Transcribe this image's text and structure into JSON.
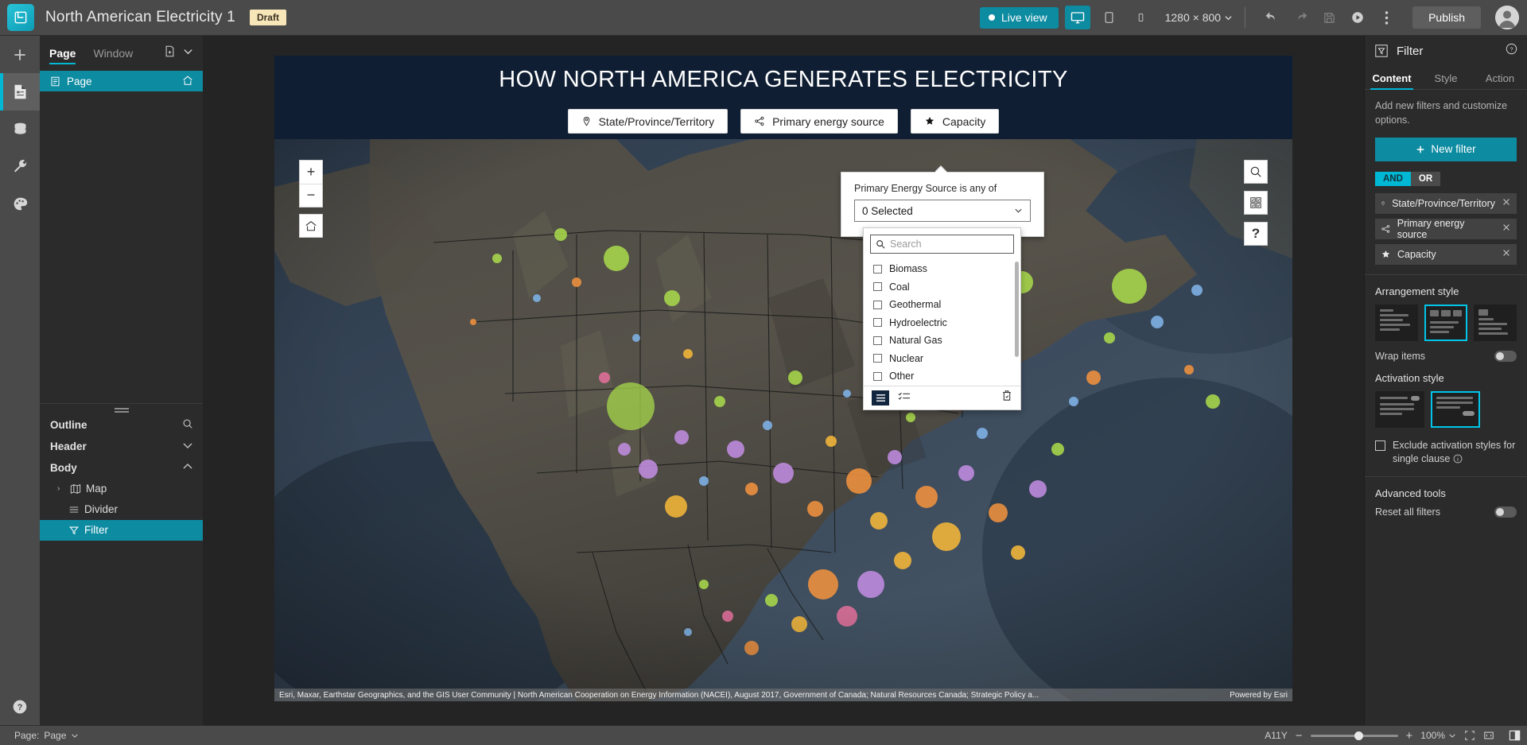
{
  "topbar": {
    "app_title": "North American Electricity 1",
    "draft_badge": "Draft",
    "live_view": "Live view",
    "device_size": "1280 × 800",
    "publish": "Publish",
    "icons": {
      "desktop": "desktop-icon",
      "tablet": "tablet-icon",
      "phone": "phone-icon",
      "undo": "undo-icon",
      "redo": "redo-icon",
      "save": "save-icon",
      "preview": "preview-icon",
      "more": "more-options-icon",
      "avatar": "user-avatar-icon"
    }
  },
  "rail": {
    "items": [
      {
        "name": "add-widget",
        "icon": "plus-icon"
      },
      {
        "name": "page-content",
        "icon": "page-document-icon",
        "active": true
      },
      {
        "name": "data",
        "icon": "database-icon"
      },
      {
        "name": "tools",
        "icon": "wrench-icon"
      },
      {
        "name": "theme",
        "icon": "palette-icon"
      }
    ],
    "help": "help-circle-icon"
  },
  "left_panel": {
    "tabs": [
      {
        "label": "Page",
        "selected": true
      },
      {
        "label": "Window",
        "selected": false
      }
    ],
    "add_page_icon": "add-page-icon",
    "chevron_icon": "chevron-down-icon",
    "pages": [
      {
        "label": "Page",
        "selected": true,
        "home": true
      }
    ],
    "outline": {
      "title": "Outline",
      "search_icon": "search-icon",
      "groups": [
        {
          "label": "Header",
          "expanded": false,
          "chevron": "chevron-down-icon"
        },
        {
          "label": "Body",
          "expanded": true,
          "chevron": "chevron-up-icon"
        }
      ],
      "items": [
        {
          "label": "Map",
          "icon": "map-icon",
          "arrow": "›",
          "selected": false
        },
        {
          "label": "Divider",
          "icon": "divider-icon",
          "arrow": "",
          "selected": false
        },
        {
          "label": "Filter",
          "icon": "filter-icon",
          "arrow": "",
          "selected": true
        }
      ]
    }
  },
  "artboard": {
    "title": "HOW NORTH AMERICA GENERATES ELECTRICITY",
    "filter_buttons": [
      {
        "label": "State/Province/Territory",
        "icon": "location-pin-icon"
      },
      {
        "label": "Primary energy source",
        "icon": "share-nodes-icon",
        "active": true
      },
      {
        "label": "Capacity",
        "icon": "star-icon"
      }
    ],
    "map_controls": {
      "zoom_in": "+",
      "zoom_out": "−",
      "home": "home-icon",
      "search": "search-icon",
      "legend": "legend-grid-icon",
      "help": "?"
    },
    "attribution": "Esri, Maxar, Earthstar Geographics, and the GIS User Community | North American Cooperation on Energy Information (NACEI), August 2017, Government of Canada; Natural Resources Canada; Strategic Policy a...",
    "powered_by": "Powered by Esri"
  },
  "popup": {
    "label": "Primary Energy Source is any of",
    "selected_text": "0 Selected",
    "chevron_icon": "chevron-down-icon",
    "search_placeholder": "Search",
    "search_icon": "search-icon",
    "options": [
      {
        "label": "Biomass",
        "checked": false
      },
      {
        "label": "Coal",
        "checked": false
      },
      {
        "label": "Geothermal",
        "checked": false
      },
      {
        "label": "Hydroelectric",
        "checked": false
      },
      {
        "label": "Natural Gas",
        "checked": false
      },
      {
        "label": "Nuclear",
        "checked": false
      },
      {
        "label": "Other",
        "checked": false
      }
    ],
    "footer_icons": {
      "list_view": "list-view-icon",
      "select_view": "checklist-icon",
      "delete": "trash-icon"
    }
  },
  "right_panel": {
    "header_title": "Filter",
    "header_icon": "filter-icon",
    "help_icon": "help-circle-icon",
    "tabs": [
      {
        "label": "Content",
        "selected": true
      },
      {
        "label": "Style",
        "selected": false
      },
      {
        "label": "Action",
        "selected": false
      }
    ],
    "description": "Add new filters and customize options.",
    "new_filter": "New filter",
    "logic": {
      "and": "AND",
      "or": "OR",
      "selected": "AND"
    },
    "clauses": [
      {
        "label": "State/Province/Territory",
        "icon": "location-pin-icon"
      },
      {
        "label": "Primary energy source",
        "icon": "share-nodes-icon"
      },
      {
        "label": "Capacity",
        "icon": "star-icon"
      }
    ],
    "arrangement_style": {
      "title": "Arrangement style",
      "selected_index": 1
    },
    "wrap_items": {
      "label": "Wrap items",
      "on": false
    },
    "activation_style": {
      "title": "Activation style",
      "selected_index": 1
    },
    "exclude": {
      "label": "Exclude activation styles for single clause",
      "checked": false,
      "info_icon": "info-icon"
    },
    "advanced_tools": {
      "title": "Advanced tools"
    },
    "reset_all": {
      "label": "Reset all filters",
      "on": false
    }
  },
  "statusbar": {
    "page_label": "Page:",
    "page_value": "Page",
    "a11y": "A11Y",
    "zoom_value": "100%",
    "minus": "−",
    "plus": "+",
    "fit_icon": "fit-screen-icon",
    "actual_icon": "actual-size-icon",
    "panel_icon": "toggle-panel-icon"
  },
  "colors": {
    "accent": "#00b7d4",
    "teal": "#0d8ba1",
    "panel": "#2b2b2b",
    "chrome": "#4a4a4a",
    "artboard_header": "#0f1e33"
  }
}
